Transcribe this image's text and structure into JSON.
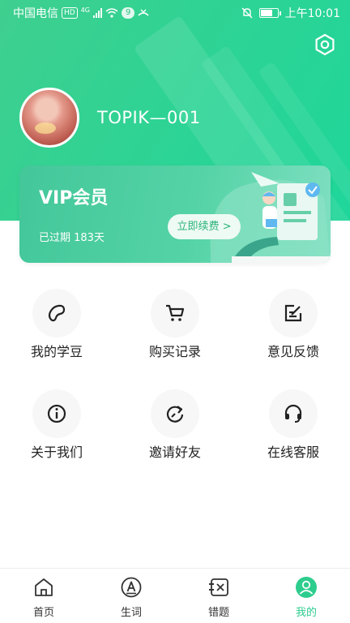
{
  "status_bar": {
    "carrier": "中国电信",
    "hd_badge": "HD",
    "network": "4G",
    "notifications": "9",
    "time": "上午10:01"
  },
  "profile": {
    "username": "TOPIK—001"
  },
  "vip": {
    "title": "VIP会员",
    "expiry_text": "已过期 183天",
    "renew_label": "立即续费 >"
  },
  "grid": [
    {
      "label": "我的学豆",
      "icon": "bean-icon"
    },
    {
      "label": "购买记录",
      "icon": "cart-icon"
    },
    {
      "label": "意见反馈",
      "icon": "feedback-icon"
    },
    {
      "label": "关于我们",
      "icon": "info-icon"
    },
    {
      "label": "邀请好友",
      "icon": "invite-icon"
    },
    {
      "label": "在线客服",
      "icon": "headset-icon"
    }
  ],
  "bottom_nav": [
    {
      "label": "首页",
      "icon": "home-icon",
      "active": false
    },
    {
      "label": "生词",
      "icon": "vocabulary-icon",
      "active": false
    },
    {
      "label": "错题",
      "icon": "wrong-questions-icon",
      "active": false
    },
    {
      "label": "我的",
      "icon": "profile-icon",
      "active": true
    }
  ],
  "colors": {
    "brand_green": "#2dcd8e",
    "card_green": "#43c79a",
    "text_dark": "#222222"
  }
}
